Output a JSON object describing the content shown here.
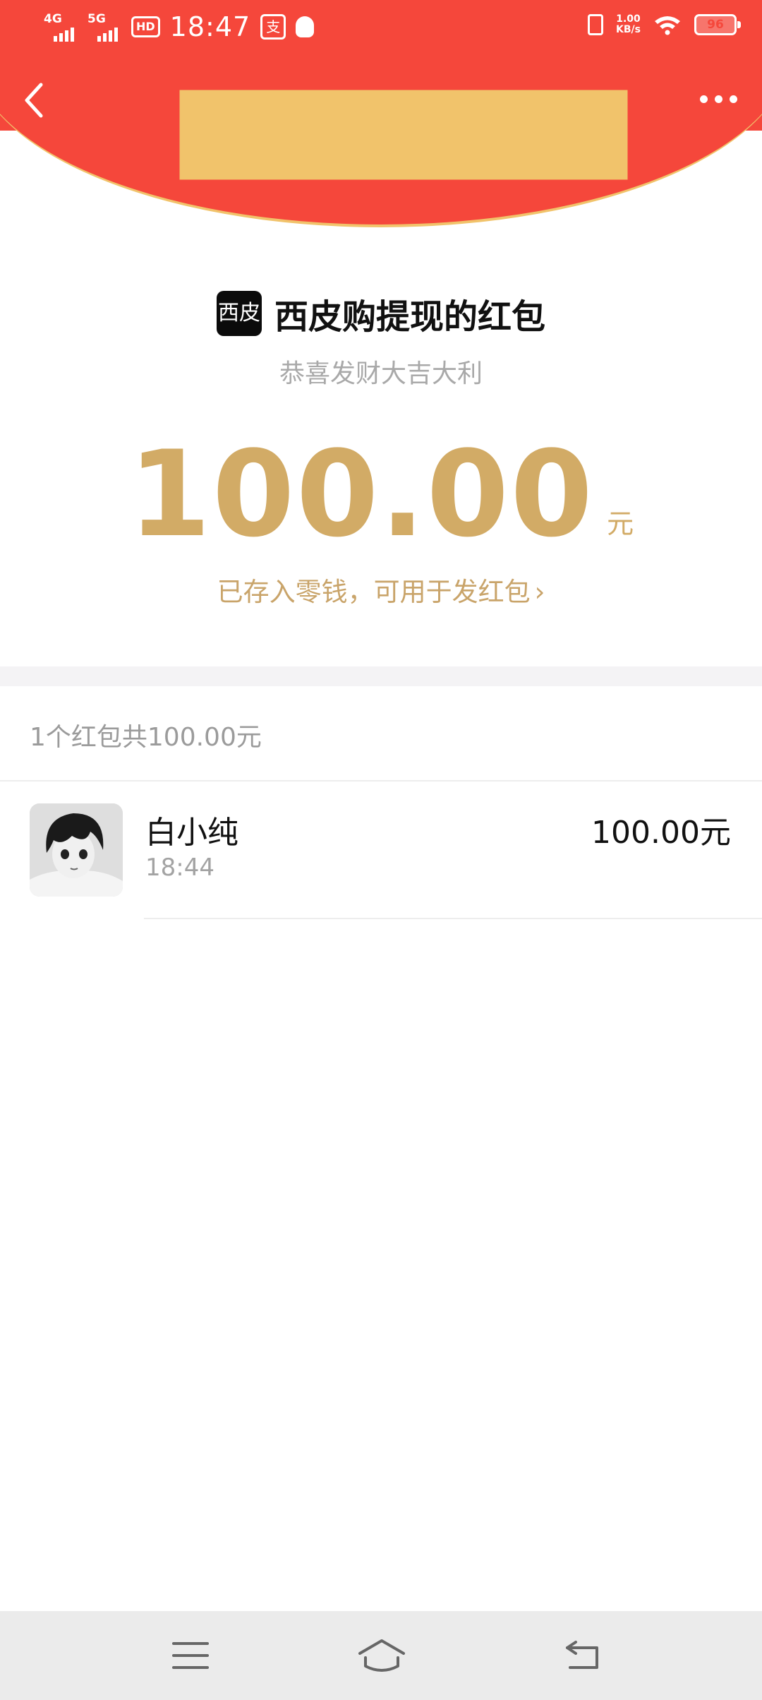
{
  "status_bar": {
    "sim1": "4G",
    "sim2": "5G",
    "hd": "HD",
    "time": "18:47",
    "alipay_glyph": "支",
    "net_speed_value": "1.00",
    "net_speed_unit": "KB/s",
    "battery": "96"
  },
  "header": {
    "back_icon": "chevron-left-icon",
    "more_icon": "more-dots-icon",
    "accent": "#f5473b",
    "arc_border": "#f1c36b"
  },
  "packet": {
    "logo_text": "西皮",
    "sender_title": "西皮购提现的红包",
    "blessing": "恭喜发财大吉大利",
    "amount": "100.00",
    "unit": "元",
    "saved_link": "已存入零钱，可用于发红包",
    "saved_chevron": "›",
    "amount_color": "#d2ab66"
  },
  "summary": {
    "count_text": "1个红包共100.00元"
  },
  "records": [
    {
      "name": "白小纯",
      "time": "18:44",
      "amount": "100.00元"
    }
  ],
  "bottom_nav": {
    "icons": [
      "menu-icon",
      "home-icon",
      "back-icon"
    ]
  }
}
